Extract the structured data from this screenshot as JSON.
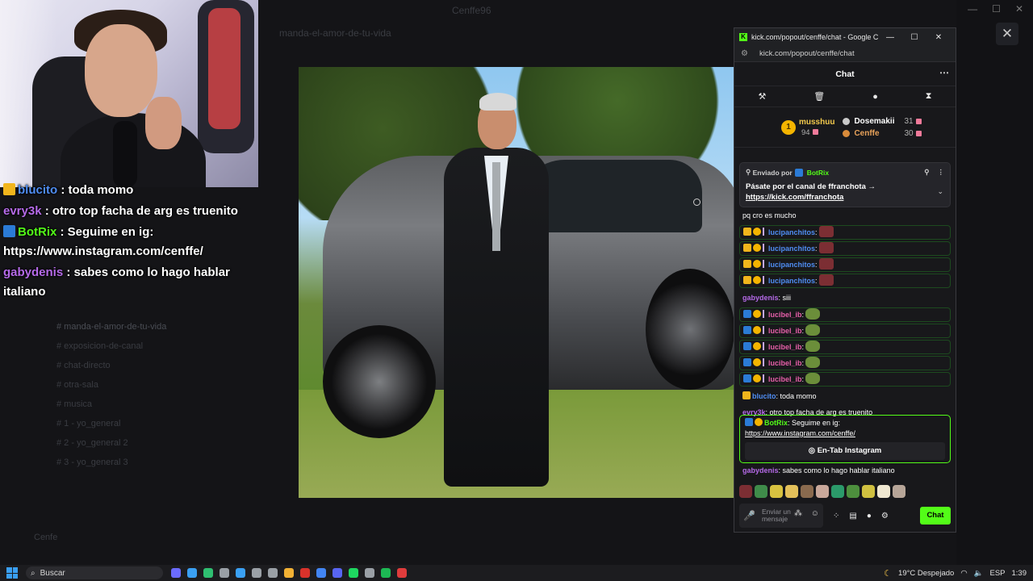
{
  "background": {
    "window_title": "Cenffe96",
    "channel_topbar": "manda-el-amor-de-tu-vida",
    "channels": [
      "manda-el-amor-de-tu-vida",
      "exposicion-de-canal",
      "chat-directo",
      "otra-sala",
      "musica",
      "1 - yo_general",
      "2 - yo_general 2",
      "3 - yo_general 3"
    ],
    "user_name": "Cenfe"
  },
  "stream_overlay_chat": [
    {
      "user": "blucito",
      "text": " : toda momo",
      "color": "#4f8df3",
      "badge": "#f1b51c"
    },
    {
      "user": "evry3k",
      "text": " : otro top facha de arg es truenito",
      "color": "#b56ae8",
      "badge": ""
    },
    {
      "user": "BotRix",
      "text": " : Seguime en ig: https://www.instagram.com/cenffe/",
      "color": "#53fc18",
      "badge": "#2b7bd6"
    },
    {
      "user": "gabydenis",
      "text": " : sabes como lo hago hablar italiano",
      "color": "#b56ae8",
      "badge": ""
    }
  ],
  "popout": {
    "window_title": "kick.com/popout/cenffe/chat - Google Chrome",
    "url": "kick.com/popout/cenffe/chat",
    "logo": "K",
    "header": "Chat",
    "leaderboard": {
      "first": {
        "rank": "1",
        "name": "musshuu",
        "points": "94"
      },
      "others": [
        {
          "name": "Dosemakii",
          "points": "31",
          "medal": "#c9c9c9"
        },
        {
          "name": "Cenffe",
          "points": "30",
          "medal": "#d98b3a"
        }
      ]
    },
    "pinned": {
      "by_label": "Enviado por",
      "by_user": "BotRix",
      "message": "Pásate por el canal de ffranchota →",
      "link": "https://kick.com/ffranchota"
    },
    "messages": [
      {
        "type": "text",
        "user": "",
        "text": "pq cro es mucho",
        "color": ""
      },
      {
        "type": "emote",
        "user": "lucipanchitos",
        "color": "u-blue",
        "badges": [
          "b-crown",
          "b-coin",
          "b-leaf"
        ],
        "emote": "red"
      },
      {
        "type": "emote",
        "user": "lucipanchitos",
        "color": "u-blue",
        "badges": [
          "b-crown",
          "b-coin",
          "b-leaf"
        ],
        "emote": "red"
      },
      {
        "type": "emote",
        "user": "lucipanchitos",
        "color": "u-blue",
        "badges": [
          "b-crown",
          "b-coin",
          "b-leaf"
        ],
        "emote": "red"
      },
      {
        "type": "emote",
        "user": "lucipanchitos",
        "color": "u-blue",
        "badges": [
          "b-crown",
          "b-coin",
          "b-leaf"
        ],
        "emote": "red"
      },
      {
        "type": "text",
        "user": "gabydenis",
        "text": ": siii",
        "color": "u-purple"
      },
      {
        "type": "emote",
        "user": "lucibel_ib",
        "color": "u-pink",
        "badges": [
          "b-sub",
          "b-coin",
          "b-leaf"
        ],
        "emote": "pickle"
      },
      {
        "type": "emote",
        "user": "lucibel_ib",
        "color": "u-pink",
        "badges": [
          "b-sub",
          "b-coin",
          "b-leaf"
        ],
        "emote": "pickle"
      },
      {
        "type": "emote",
        "user": "lucibel_ib",
        "color": "u-pink",
        "badges": [
          "b-sub",
          "b-coin",
          "b-leaf"
        ],
        "emote": "pickle"
      },
      {
        "type": "emote",
        "user": "lucibel_ib",
        "color": "u-pink",
        "badges": [
          "b-sub",
          "b-coin",
          "b-leaf"
        ],
        "emote": "pickle"
      },
      {
        "type": "emote",
        "user": "lucibel_ib",
        "color": "u-pink",
        "badges": [
          "b-sub",
          "b-coin",
          "b-leaf"
        ],
        "emote": "pickle"
      },
      {
        "type": "text",
        "user": "blucito",
        "text": ": toda momo",
        "color": "u-blue",
        "badges": [
          "b-crown"
        ]
      },
      {
        "type": "text",
        "user": "evry3k",
        "text": ": otro top facha de arg es truenito",
        "color": "u-purple"
      }
    ],
    "promo": {
      "user": "BotRix",
      "text": ": Seguime en ig:",
      "link": "https://www.instagram.com/cenffe/",
      "button": "En-Tab Instagram"
    },
    "last_message": {
      "user": "gabydenis",
      "text": ": sabes como lo hago hablar italiano"
    },
    "emote_colors": [
      "#7c2e33",
      "#3f8c4a",
      "#d8c240",
      "#e3c05a",
      "#8a6a4e",
      "#c9a89b",
      "#2b9a6a",
      "#4d8f3d",
      "#d0c040",
      "#efe7d0",
      "#b7a598"
    ],
    "input_placeholder": "Enviar un mensaje",
    "send_label": "Chat"
  },
  "taskbar": {
    "search_label": "Buscar",
    "weather": "19°C  Despejado",
    "lang": "ESP",
    "time": "1:39",
    "app_colors": [
      "#6b6bff",
      "#3aa0f3",
      "#2fbf71",
      "#9aa0a6",
      "#3aa0f3",
      "#9aa0a6",
      "#9aa0a6",
      "#f2b134",
      "#d9322b",
      "#4285f4",
      "#5865f2",
      "#1ed760",
      "#9aa0a6",
      "#1db954",
      "#e03c3c"
    ]
  }
}
